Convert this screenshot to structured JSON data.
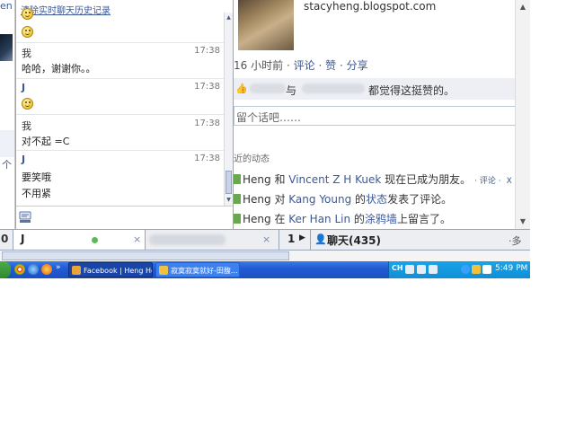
{
  "left_edge": {
    "text": "en",
    "mid_text": "个"
  },
  "chat_window": {
    "clear_history_link": "清除实时聊天历史记录",
    "messages": [
      {
        "sender": "我",
        "time": "17:38",
        "lines": [
          "哈哈，谢谢你。。"
        ]
      },
      {
        "sender": "J",
        "time": "17:38",
        "lines": []
      },
      {
        "sender": "我",
        "time": "17:38",
        "lines": [
          "对不起 =C"
        ]
      },
      {
        "sender": "J",
        "time": "17:38",
        "lines": [
          "要笑哦",
          "不用紧"
        ]
      }
    ],
    "scroll_up_glyph": "▲",
    "scroll_down_glyph": "▼"
  },
  "feed": {
    "blog_url": "stacyheng.blogspot.com",
    "meta": {
      "count": "16",
      "ago": "小时前",
      "sep": "·",
      "comment": "评论",
      "like": "赞",
      "share": "分享"
    },
    "like_bar": {
      "connector": "与",
      "suffix": "都觉得这挺赞的。"
    },
    "comment_placeholder": "留个话吧……",
    "recent_label": "近的动态",
    "activities": [
      {
        "pre": "Heng 和 ",
        "link1": "Vincent Z H Kuek",
        "mid": " 现在已成为朋友。",
        "link2": "",
        "post": "",
        "small": "· 评论 ·",
        "x": "X"
      },
      {
        "pre": "Heng 对 ",
        "link1": "Kang Young",
        "mid": " 的",
        "link2": "状态",
        "post": "发表了评论。",
        "small": "",
        "x": ""
      },
      {
        "pre": "Heng 在 ",
        "link1": "Ker Han Lin",
        "mid": " 的",
        "link2": "涂鸦墙",
        "post": "上留言了。",
        "small": "",
        "x": ""
      }
    ]
  },
  "chat_bar": {
    "left_count": "0",
    "tab1_name": "J",
    "tab_close": "×",
    "chat_count": "1",
    "chat_label": "聊天(435)",
    "gear": "·多",
    "status_color": "#5cb85c"
  },
  "taskbar": {
    "more": "»",
    "tasks": [
      {
        "label": "Facebook | Heng Hoe...",
        "icon_color": "#e8a33a"
      },
      {
        "label": "寂寞寂寞就好-田馥...",
        "icon_color": "#f0c040"
      }
    ],
    "lang": "CH",
    "clock": "5:49 PM"
  }
}
